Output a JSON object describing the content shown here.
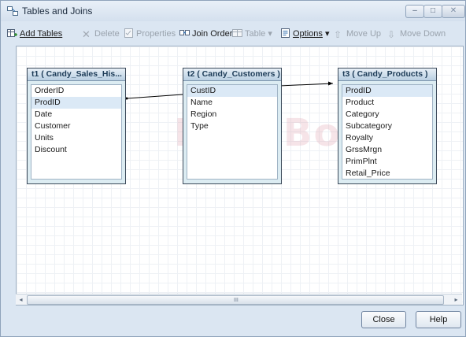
{
  "window": {
    "title": "Tables and Joins"
  },
  "titlebar": {
    "minimize_glyph": "–",
    "maximize_glyph": "□",
    "close_glyph": "✕"
  },
  "toolbar": {
    "add_tables": "Add Tables",
    "delete": "Delete",
    "properties": "Properties",
    "join_order": "Join Order",
    "table": "Table",
    "options": "Options",
    "move_up": "Move Up",
    "move_down": "Move Down",
    "dropdown_glyph": "▾"
  },
  "tables": [
    {
      "title": "t1 ( Candy_Sales_His...",
      "columns": [
        "OrderID",
        "ProdID",
        "Date",
        "Customer",
        "Units",
        "Discount"
      ],
      "selected": "ProdID"
    },
    {
      "title": "t2 ( Candy_Customers )",
      "columns": [
        "CustID",
        "Name",
        "Region",
        "Type"
      ],
      "selected": "CustID"
    },
    {
      "title": "t3 ( Candy_Products )",
      "columns": [
        "ProdID",
        "Product",
        "Category",
        "Subcategory",
        "Royalty",
        "GrssMrgn",
        "PrimPlnt",
        "Retail_Price"
      ],
      "selected": "ProdID"
    }
  ],
  "watermark": "DropBooks",
  "scrollbar": {
    "left_arrow": "◂",
    "right_arrow": "▸",
    "grip": "III"
  },
  "buttons": {
    "close": "Close",
    "help": "Help"
  },
  "colors": {
    "link_line": "#000000",
    "table_border": "#3c4a5a",
    "header_text": "#1c3b57"
  }
}
